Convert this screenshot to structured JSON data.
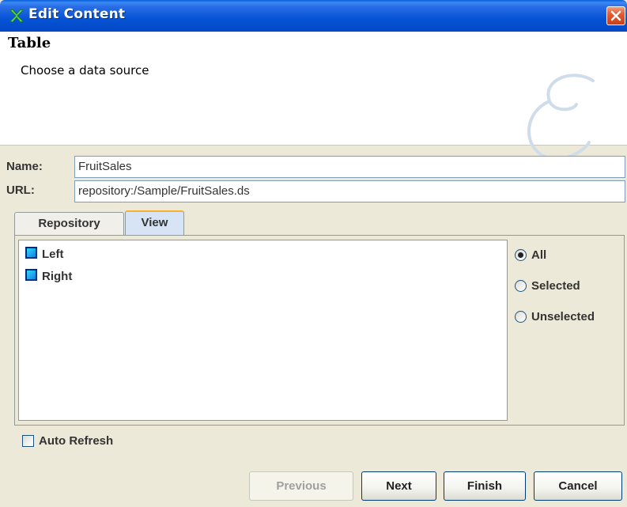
{
  "window": {
    "title": "Edit Content"
  },
  "header": {
    "title": "Table",
    "subtitle": "Choose a data source"
  },
  "fields": {
    "name_label": "Name:",
    "name_value": "FruitSales",
    "url_label": "URL:",
    "url_value": "repository:/Sample/FruitSales.ds"
  },
  "tabs": [
    {
      "label": "Repository",
      "selected": false
    },
    {
      "label": "View",
      "selected": true
    }
  ],
  "view_list": {
    "items": [
      {
        "label": "Left",
        "icon": "table-node-icon"
      },
      {
        "label": "Right",
        "icon": "table-node-icon"
      }
    ]
  },
  "filter": {
    "options": [
      {
        "label": "All",
        "checked": true
      },
      {
        "label": "Selected",
        "checked": false
      },
      {
        "label": "Unselected",
        "checked": false
      }
    ]
  },
  "auto_refresh": {
    "label": "Auto Refresh",
    "checked": false
  },
  "buttons": {
    "previous": "Previous",
    "next": "Next",
    "finish": "Finish",
    "cancel": "Cancel"
  },
  "colors": {
    "titlebar": "#0553d6",
    "selected_tab": "#d6e4f5",
    "tab_highlight": "#f5b12a",
    "close_button": "#e45b32"
  }
}
